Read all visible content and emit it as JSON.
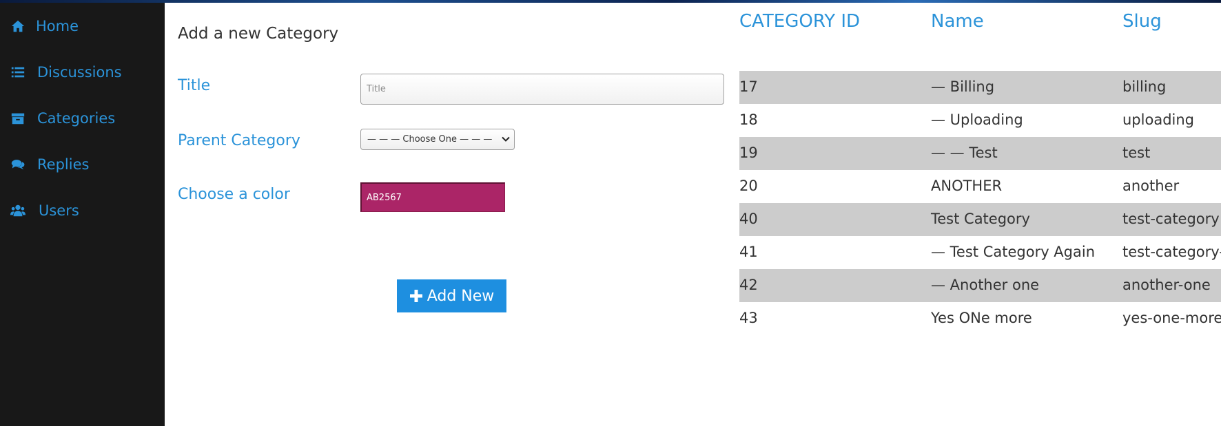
{
  "sidebar": {
    "items": [
      {
        "label": "Home",
        "icon": "home-icon"
      },
      {
        "label": "Discussions",
        "icon": "list-icon"
      },
      {
        "label": "Categories",
        "icon": "archive-icon"
      },
      {
        "label": "Replies",
        "icon": "comments-icon"
      },
      {
        "label": "Users",
        "icon": "users-icon"
      }
    ]
  },
  "form": {
    "title": "Add a new Category",
    "title_label": "Title",
    "title_placeholder": "Title",
    "title_value": "",
    "parent_label": "Parent Category",
    "parent_selected": "— — — Choose One — — —",
    "color_label": "Choose a color",
    "color_value": "AB2567",
    "color_hex": "#AB2567",
    "submit_label": "Add New"
  },
  "table": {
    "headers": [
      "CATEGORY ID",
      "Name",
      "Slug"
    ],
    "rows": [
      {
        "id": "17",
        "name": "— Billing",
        "slug": "billing"
      },
      {
        "id": "18",
        "name": "— Uploading",
        "slug": "uploading"
      },
      {
        "id": "19",
        "name": "— — Test",
        "slug": "test"
      },
      {
        "id": "20",
        "name": "ANOTHER",
        "slug": "another"
      },
      {
        "id": "40",
        "name": "Test Category",
        "slug": "test-category"
      },
      {
        "id": "41",
        "name": "— Test Category Again",
        "slug": "test-category-"
      },
      {
        "id": "42",
        "name": "— Another one",
        "slug": "another-one"
      },
      {
        "id": "43",
        "name": "Yes ONe more",
        "slug": "yes-one-more"
      }
    ]
  },
  "colors": {
    "accent": "#2B93D9",
    "sidebar_bg": "#181818",
    "button_bg": "#1E8FE0",
    "row_shade": "#CCCCCC"
  }
}
